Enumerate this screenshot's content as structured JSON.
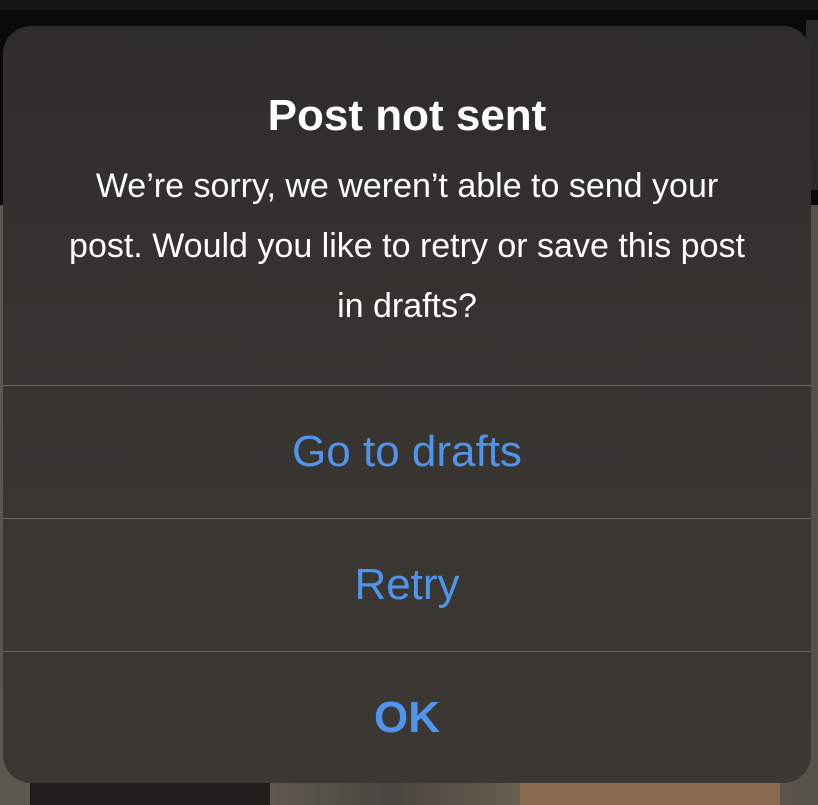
{
  "alert": {
    "title": "Post not sent",
    "message": "We’re sorry, we weren’t able to send your post. Would you like to retry or save this post in drafts?",
    "actions": [
      {
        "label": "Go to drafts"
      },
      {
        "label": "Retry"
      },
      {
        "label": "OK"
      }
    ]
  },
  "colors": {
    "action_text": "#4f95ee",
    "title_text": "#ffffff",
    "alert_background": "#35322f",
    "divider": "#6c6761"
  }
}
